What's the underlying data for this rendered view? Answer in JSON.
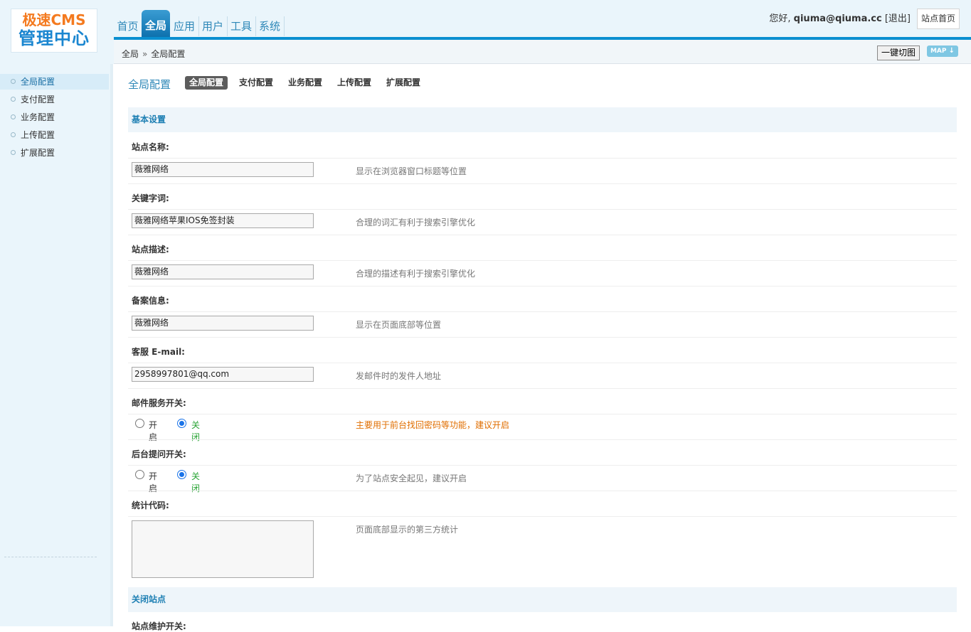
{
  "logo": {
    "line1": "极速CMS",
    "line2": "管理中心"
  },
  "nav": [
    {
      "label": "首页"
    },
    {
      "label": "全局",
      "active": true
    },
    {
      "label": "应用"
    },
    {
      "label": "用户"
    },
    {
      "label": "工具"
    },
    {
      "label": "系统"
    }
  ],
  "user": {
    "greeting": "您好,",
    "name": "qiuma@qiuma.cc",
    "logout": "[退出]",
    "home_button": "站点首页"
  },
  "breadcrumb": {
    "root": "全局",
    "separator": "»",
    "current": "全局配置"
  },
  "toolbar": {
    "crop_button": "一键切图",
    "map_button": "MAP"
  },
  "sidebar": {
    "items": [
      {
        "label": "全局配置",
        "active": true
      },
      {
        "label": "支付配置"
      },
      {
        "label": "业务配置"
      },
      {
        "label": "上传配置"
      },
      {
        "label": "扩展配置"
      }
    ]
  },
  "main": {
    "title": "全局配置",
    "tabs": [
      {
        "label": "全局配置",
        "active": true
      },
      {
        "label": "支付配置"
      },
      {
        "label": "业务配置"
      },
      {
        "label": "上传配置"
      },
      {
        "label": "扩展配置"
      }
    ],
    "section_basic": "基本设置",
    "fields": {
      "site_name": {
        "label": "站点名称:",
        "value": "薇雅网络",
        "hint": "显示在浏览器窗口标题等位置"
      },
      "keywords": {
        "label": "关键字词:",
        "value": "薇雅网络苹果IOS免签封装",
        "hint": "合理的词汇有利于搜索引擎优化"
      },
      "description": {
        "label": "站点描述:",
        "value": "薇雅网络",
        "hint": "合理的描述有利于搜索引擎优化"
      },
      "icp": {
        "label": "备案信息:",
        "value": "薇雅网络",
        "hint": "显示在页面底部等位置"
      },
      "email": {
        "label": "客服 E-mail:",
        "value": "2958997801@qq.com",
        "hint": "发邮件时的发件人地址"
      },
      "mail_switch": {
        "label": "邮件服务开关:",
        "on": "开启",
        "off": "关闭",
        "selected": "关闭",
        "hint": "主要用于前台找回密码等功能，建议开启"
      },
      "admin_question": {
        "label": "后台提问开关:",
        "on": "开启",
        "off": "关闭",
        "selected": "关闭",
        "hint": "为了站点安全起见，建议开启"
      },
      "stats_code": {
        "label": "统计代码:",
        "value": "",
        "hint": "页面底部显示的第三方统计"
      }
    },
    "section_close": "关闭站点",
    "maintenance_label": "站点维护开关:"
  },
  "colors": {
    "accent": "#0a8fd0",
    "nav_active": "#1a7fc0",
    "warn": "#e06e00",
    "checked_label": "#27a333"
  }
}
